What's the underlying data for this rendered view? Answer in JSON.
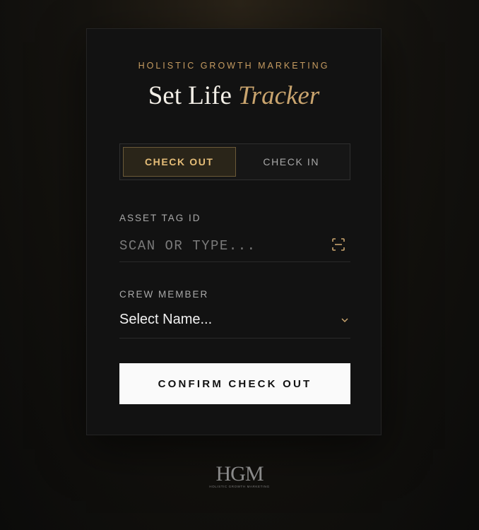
{
  "header": {
    "eyebrow": "HOLISTIC GROWTH MARKETING",
    "title_main": "Set Life",
    "title_accent": "Tracker"
  },
  "mode_toggle": {
    "options": [
      {
        "label": "CHECK OUT",
        "active": true
      },
      {
        "label": "CHECK IN",
        "active": false
      }
    ]
  },
  "asset_field": {
    "label": "ASSET TAG ID",
    "value": "",
    "placeholder": "SCAN OR TYPE...",
    "icon": "scan-icon"
  },
  "crew_field": {
    "label": "CREW MEMBER",
    "selected": "Select Name...",
    "icon": "chevron-down-icon"
  },
  "confirm_button": {
    "label": "CONFIRM CHECK OUT"
  },
  "footer": {
    "logo_mark": "HGM",
    "logo_text": "HOLISTIC GROWTH MARKETING"
  },
  "colors": {
    "accent_gold": "#c69c61",
    "card_bg": "#121212",
    "button_bg": "#fafafa"
  }
}
